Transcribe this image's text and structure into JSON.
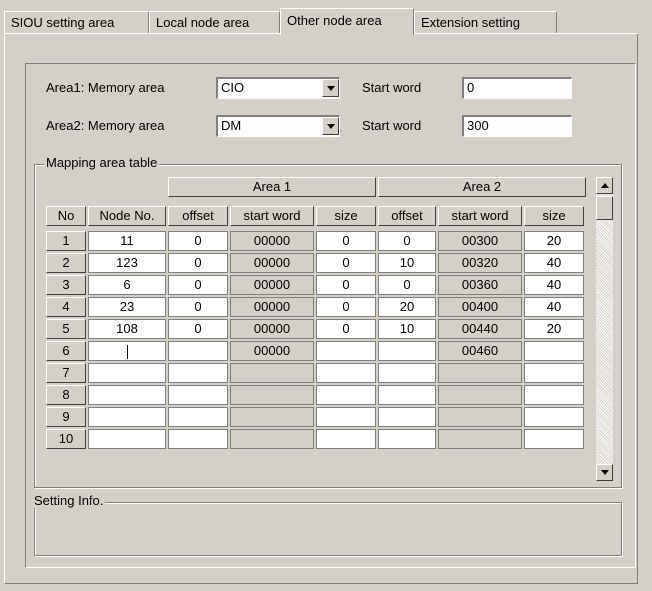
{
  "tabs": [
    {
      "label": "SIOU setting area",
      "active": false
    },
    {
      "label": "Local node area",
      "active": false
    },
    {
      "label": "Other node area",
      "active": true
    },
    {
      "label": "Extension setting",
      "active": false
    }
  ],
  "area1": {
    "label": "Area1: Memory area",
    "memory": "CIO",
    "start_label": "Start word",
    "start_value": "0"
  },
  "area2": {
    "label": "Area2: Memory area",
    "memory": "DM",
    "start_label": "Start word",
    "start_value": "300"
  },
  "mapping": {
    "title": "Mapping area table",
    "group_headers": [
      "Area 1",
      "Area 2"
    ],
    "columns": [
      "No",
      "Node No.",
      "offset",
      "start word",
      "size",
      "offset",
      "start word",
      "size"
    ],
    "rows": [
      [
        "1",
        "11",
        "0",
        "00000",
        "0",
        "0",
        "00300",
        "20"
      ],
      [
        "2",
        "123",
        "0",
        "00000",
        "0",
        "10",
        "00320",
        "40"
      ],
      [
        "3",
        "6",
        "0",
        "00000",
        "0",
        "0",
        "00360",
        "40"
      ],
      [
        "4",
        "23",
        "0",
        "00000",
        "0",
        "20",
        "00400",
        "40"
      ],
      [
        "5",
        "108",
        "0",
        "00000",
        "0",
        "10",
        "00440",
        "20"
      ],
      [
        "6",
        "",
        "",
        "00000",
        "",
        "",
        "00460",
        ""
      ],
      [
        "7",
        "",
        "",
        "",
        "",
        "",
        "",
        ""
      ],
      [
        "8",
        "",
        "",
        "",
        "",
        "",
        "",
        ""
      ],
      [
        "9",
        "",
        "",
        "",
        "",
        "",
        "",
        ""
      ],
      [
        "10",
        "",
        "",
        "",
        "",
        "",
        "",
        ""
      ]
    ]
  },
  "setting_info": {
    "title": "Setting Info.",
    "text": ""
  }
}
